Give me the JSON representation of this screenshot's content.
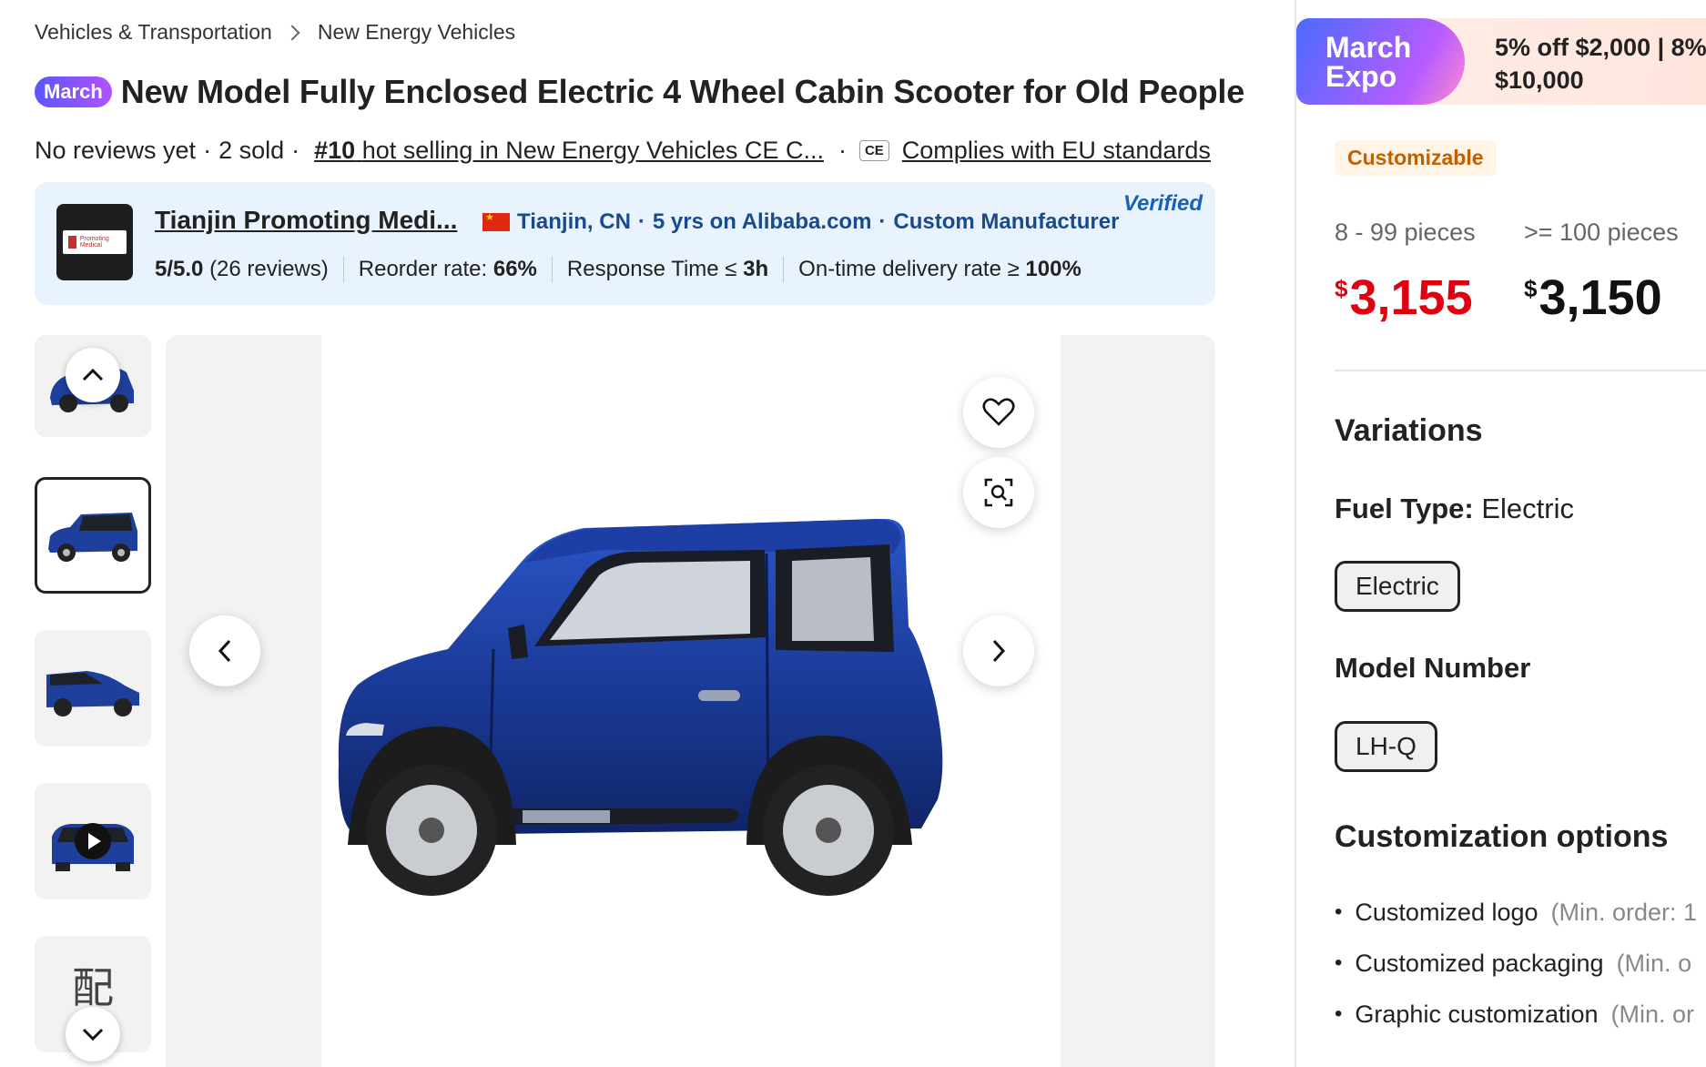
{
  "breadcrumb": [
    "Vehicles & Transportation",
    "New Energy Vehicles"
  ],
  "title_badge": "March",
  "title": "New Model Fully Enclosed Electric 4 Wheel Cabin Scooter for Old People",
  "meta": {
    "reviews": "No reviews yet",
    "sold": "2 sold",
    "rank_number": "#10",
    "rank_text": "hot selling in New Energy Vehicles CE C...",
    "ce_mark": "CE",
    "compliance": "Complies with EU standards"
  },
  "supplier": {
    "name": "Tianjin Promoting Medi...",
    "logo_text": "Promoting Medical",
    "location": "Tianjin, CN",
    "years": "5 yrs on Alibaba.com",
    "type": "Custom Manufacturer",
    "verified": "Verified",
    "rating": "5/5.0",
    "reviews": "(26 reviews)",
    "reorder_label": "Reorder rate:",
    "reorder_value": "66%",
    "response_label": "Response Time ≤",
    "response_value": "3h",
    "ontime_label": "On-time delivery rate ≥",
    "ontime_value": "100%"
  },
  "thumbnails": {
    "last_glyph": "配"
  },
  "promo": {
    "logo_line1": "March",
    "logo_line2": "Expo",
    "text_line1": "5% off $2,000 | 8%",
    "text_line2": "$10,000"
  },
  "badge": "Customizable",
  "price_tiers": [
    {
      "label": "8 - 99 pieces",
      "currency": "$",
      "amount": "3,155"
    },
    {
      "label": ">= 100 pieces",
      "currency": "$",
      "amount": "3,150"
    }
  ],
  "variations": {
    "heading": "Variations",
    "fuel_label": "Fuel Type:",
    "fuel_value": "Electric",
    "fuel_option": "Electric",
    "model_heading": "Model Number",
    "model_option": "LH-Q"
  },
  "customization": {
    "heading": "Customization options",
    "items": [
      {
        "label": "Customized logo",
        "min": "(Min. order: 1"
      },
      {
        "label": "Customized packaging",
        "min": "(Min. o"
      },
      {
        "label": "Graphic customization",
        "min": "(Min. or"
      }
    ]
  },
  "colors": {
    "price_red": "#e0000f",
    "accent_blue": "#1a4a8e",
    "car_blue": "#1e3f9c"
  }
}
